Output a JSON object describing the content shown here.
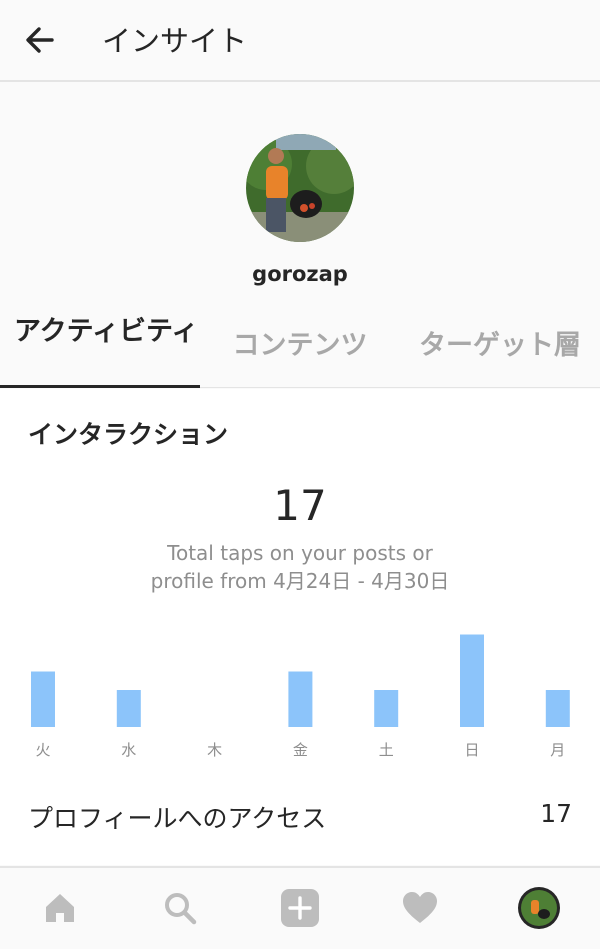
{
  "header": {
    "title": "インサイト",
    "back_icon": "arrow-left-icon"
  },
  "profile": {
    "username": "gorozap"
  },
  "tabs": [
    {
      "label": "アクティビティ",
      "active": true
    },
    {
      "label": "コンテンツ",
      "active": false
    },
    {
      "label": "ターゲット層",
      "active": false
    }
  ],
  "interactions": {
    "title": "インタラクション",
    "total": "17",
    "description_line1": "Total taps on your posts or",
    "description_line2": "profile from 4月24日 - 4月30日",
    "profile_access_label": "プロフィールへのアクセス",
    "profile_access_value": "17"
  },
  "chart_data": {
    "type": "bar",
    "categories": [
      "火",
      "水",
      "木",
      "金",
      "土",
      "日",
      "月"
    ],
    "values": [
      3,
      2,
      0,
      3,
      2,
      5,
      2
    ],
    "color": "#8cc4fa"
  },
  "bottom_nav": [
    "home-icon",
    "search-icon",
    "add-icon",
    "heart-icon",
    "profile-avatar"
  ],
  "colors": {
    "bar": "#8cc4fa",
    "background": "#fafafa",
    "text": "#262626",
    "muted": "#8e8e8e"
  }
}
